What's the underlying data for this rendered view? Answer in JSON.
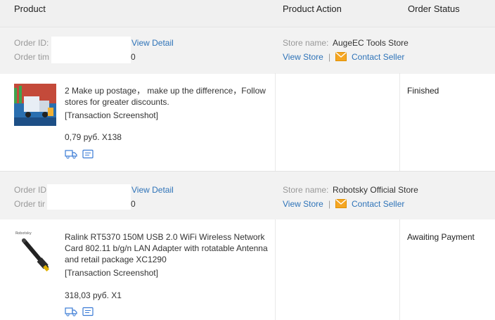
{
  "header": {
    "product": "Product",
    "product_action": "Product Action",
    "order_status": "Order Status"
  },
  "orders": [
    {
      "order_id_label": "Order ID:",
      "order_time_label": "Order tim",
      "order_time_tail": "0",
      "view_detail": "View Detail",
      "store_label": "Store name:",
      "store_name": "AugeEC Tools Store",
      "view_store": "View Store",
      "separator": "|",
      "contact_seller": "Contact Seller",
      "product_title": "2 Make up postage，  make up the difference，Follow stores for greater discounts.",
      "screenshot_link": "[Transaction Screenshot]",
      "price": "0,79 руб. X138",
      "status": "Finished"
    },
    {
      "order_id_label": "Order ID",
      "order_time_label": "Order tir",
      "order_time_tail": "0",
      "view_detail": "View Detail",
      "store_label": "Store name:",
      "store_name": "Robotsky Official Store",
      "view_store": "View Store",
      "separator": "|",
      "contact_seller": "Contact Seller",
      "product_title": "Ralink RT5370 150M USB 2.0 WiFi Wireless Network Card 802.11 b/g/n LAN Adapter with rotatable Antenna and retail package XC1290",
      "screenshot_link": "[Transaction Screenshot]",
      "price": "318,03 руб. X1",
      "status": "Awaiting Payment"
    }
  ],
  "icons": {
    "shipping": "truck-icon",
    "message": "message-icon",
    "mail": "mail-icon"
  },
  "colors": {
    "link": "#2e73b8",
    "label": "#999999",
    "mail_icon": "#f5a623",
    "row_bg": "#f2f2f2"
  }
}
